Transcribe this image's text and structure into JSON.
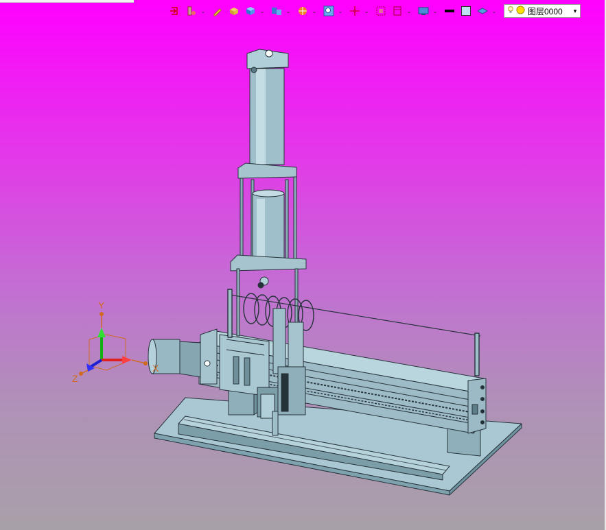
{
  "toolbar": {
    "layer_label": "图层0000",
    "icons": [
      "exit-sketch-icon",
      "pipe-icon",
      "edit-icon",
      "part-icon",
      "solid-icon",
      "assembly-icon",
      "render-icon",
      "zoom-icon",
      "snap-icon",
      "fit-icon",
      "view-icon",
      "display-icon",
      "line-color-icon",
      "fill-color-icon",
      "layer-visibility-icon",
      "bulb-icon",
      "layer-color-icon"
    ]
  },
  "axes": {
    "x_label": "X",
    "y_label": "Y",
    "z_label": "Z"
  },
  "colors": {
    "model_fill": "#9fbfca",
    "model_stroke": "#2a3338",
    "accent": "#e0007c"
  }
}
